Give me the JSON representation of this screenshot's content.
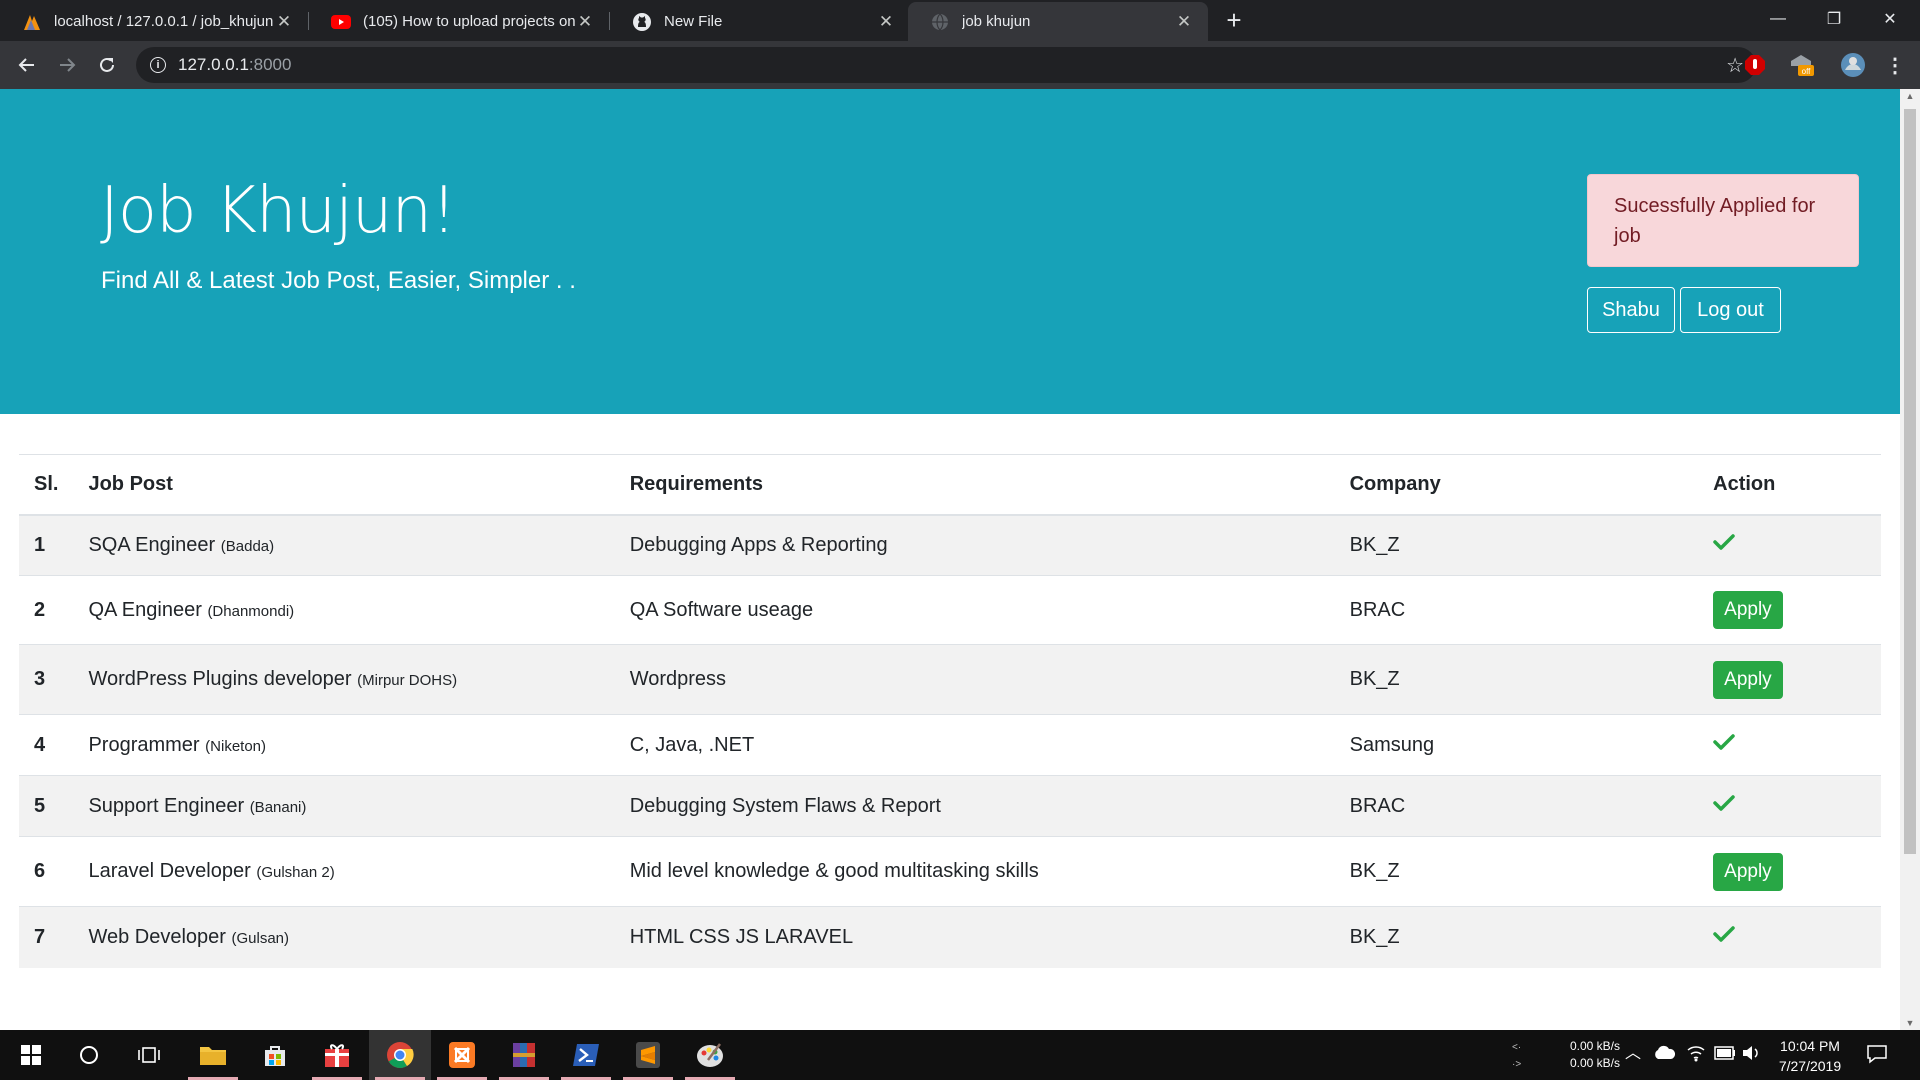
{
  "browser": {
    "tabs": [
      {
        "title": "localhost / 127.0.0.1 / job_khujun",
        "icon": "phpmyadmin-icon"
      },
      {
        "title": "(105) How to upload projects on",
        "icon": "youtube-icon"
      },
      {
        "title": "New File",
        "icon": "github-icon"
      },
      {
        "title": "job khujun",
        "icon": "globe-icon"
      }
    ],
    "url_host": "127.0.0.1",
    "url_port": ":8000",
    "ext_badge": "off"
  },
  "header": {
    "title": "Job Khujun!",
    "tagline": "Find All & Latest Job Post, Easier, Simpler . .",
    "alert": "Sucessfully Applied for job",
    "user_button": "Shabu",
    "logout_button": "Log out"
  },
  "table": {
    "headers": [
      "Sl.",
      "Job Post",
      "Requirements",
      "Company",
      "Action"
    ],
    "rows": [
      {
        "sl": "1",
        "post": "SQA Engineer",
        "location": "(Badda)",
        "requirements": "Debugging Apps & Reporting",
        "company": "BK_Z",
        "action": "applied"
      },
      {
        "sl": "2",
        "post": "QA Engineer",
        "location": "(Dhanmondi)",
        "requirements": "QA Software useage",
        "company": "BRAC",
        "action": "Apply"
      },
      {
        "sl": "3",
        "post": "WordPress Plugins developer",
        "location": "(Mirpur DOHS)",
        "requirements": "Wordpress",
        "company": "BK_Z",
        "action": "Apply"
      },
      {
        "sl": "4",
        "post": "Programmer",
        "location": "(Niketon)",
        "requirements": "C, Java, .NET",
        "company": "Samsung",
        "action": "applied"
      },
      {
        "sl": "5",
        "post": "Support Engineer",
        "location": "(Banani)",
        "requirements": "Debugging System Flaws & Report",
        "company": "BRAC",
        "action": "applied"
      },
      {
        "sl": "6",
        "post": "Laravel Developer",
        "location": "(Gulshan 2)",
        "requirements": "Mid level knowledge & good multitasking skills",
        "company": "BK_Z",
        "action": "Apply"
      },
      {
        "sl": "7",
        "post": "Web Developer",
        "location": "(Gulsan)",
        "requirements": "HTML CSS JS LARAVEL",
        "company": "BK_Z",
        "action": "applied"
      }
    ]
  },
  "taskbar": {
    "net_up": "0.00 kB/s",
    "net_down": "0.00 kB/s",
    "time": "10:04 PM",
    "date": "7/27/2019"
  },
  "colors": {
    "jumbotron": "#17a2b8",
    "alert_bg": "#f8d7da",
    "alert_text": "#721c24",
    "success": "#28a745"
  }
}
